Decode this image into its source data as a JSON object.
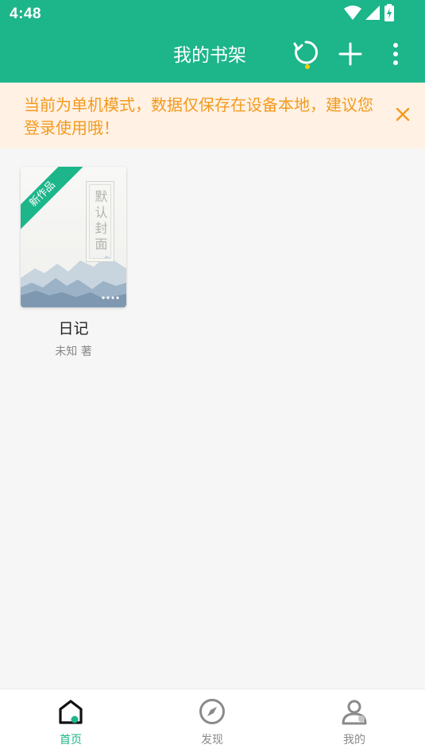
{
  "status_bar": {
    "time": "4:48",
    "icons": [
      "wifi-icon",
      "cellular-signal-icon",
      "battery-charging-icon"
    ]
  },
  "app_bar": {
    "title": "我的书架",
    "actions": [
      "sync-icon",
      "add-icon",
      "more-vert-icon"
    ],
    "sync_indicator_color": "#ffcc00"
  },
  "notice": {
    "text": "当前为单机模式，数据仅保存在设备本地，建议您登录使用哦！",
    "close_icon": "close-icon"
  },
  "books": [
    {
      "title": "日记",
      "author": "未知 著",
      "badge": "新作品",
      "cover_text": "默认封面"
    }
  ],
  "bottom_nav": {
    "items": [
      {
        "label": "首页",
        "icon": "home-icon",
        "active": true
      },
      {
        "label": "发现",
        "icon": "compass-icon",
        "active": false
      },
      {
        "label": "我的",
        "icon": "profile-icon",
        "active": false
      }
    ]
  },
  "colors": {
    "primary": "#1db58a",
    "notice_bg": "#fff1e4",
    "notice_text": "#f39a1e",
    "nav_active": "#1db58a",
    "nav_inactive": "#8a8a8a"
  }
}
